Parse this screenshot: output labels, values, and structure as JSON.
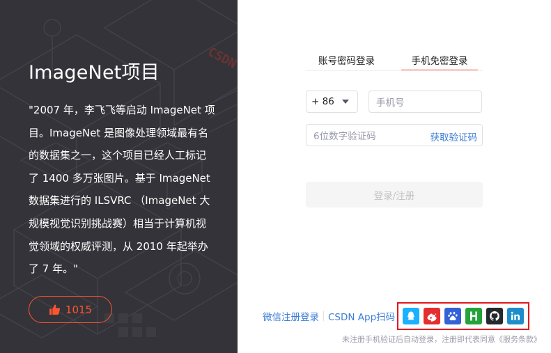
{
  "promo": {
    "title": "ImageNet项目",
    "quote": "\"2007 年，李飞飞等启动 ImageNet 项目。ImageNet 是图像处理领域最有名的数据集之一，这个项目已经人工标记了 1400 多万张图片。基于 ImageNet 数据集进行的 ILSVRC （ImageNet 大规模视觉识别挑战赛）相当于计算机视觉领域的权威评测，从 2010 年起举办了 7 年。\"",
    "like_count": "1015",
    "art_text": "CSDN"
  },
  "login": {
    "tabs": [
      {
        "label": "账号密码登录",
        "active": false
      },
      {
        "label": "手机免密登录",
        "active": true
      }
    ],
    "country_code": "+ 86",
    "phone_placeholder": "手机号",
    "code_placeholder": "6位数字验证码",
    "get_code_label": "获取验证码",
    "submit_label": "登录/注册",
    "wechat_link": "微信注册登录",
    "app_scan_link": "CSDN App扫码",
    "social_icons": [
      "qq-icon",
      "weibo-icon",
      "baidu-icon",
      "huawei-icon",
      "github-icon",
      "linkedin-icon"
    ],
    "agreement_text": "未注册手机验证后自动登录，注册即代表同意",
    "agreement_link": "《服务条款》"
  },
  "colors": {
    "accent": "#fc5531",
    "link": "#3d7ed6",
    "highlight_box": "#e0191f",
    "panel_bg": "#3b3a40"
  }
}
